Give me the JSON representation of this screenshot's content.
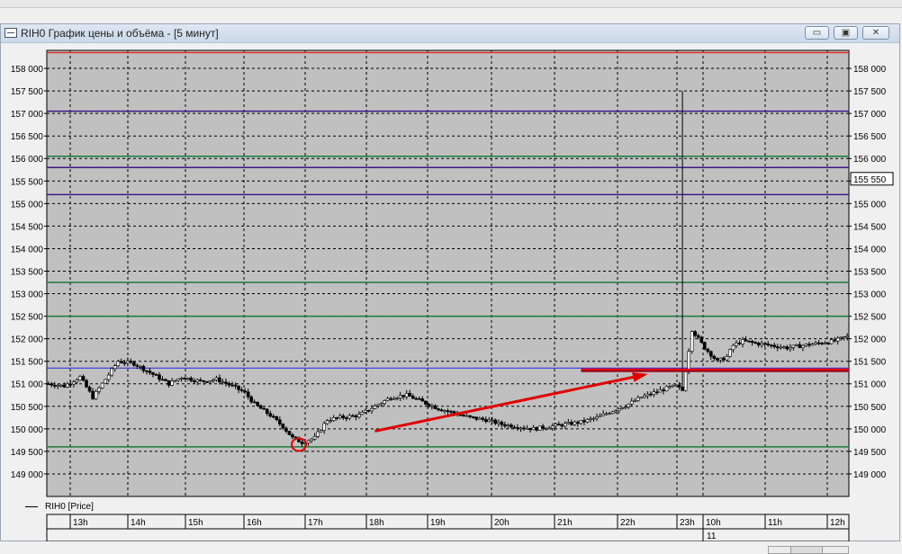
{
  "window": {
    "title": "RIH0 График цены и объёма - [5 минут]",
    "buttons": {
      "minimize": "▭",
      "restore": "▣",
      "close": "✕"
    }
  },
  "legend": {
    "series_label": "RIH0 [Price]"
  },
  "colors": {
    "plot_bg": "#c0c0c0",
    "red_level": "#e03030",
    "purple_level": "#3a1a8a",
    "green_level": "#1e7a3a",
    "blue_level": "#2a2ae0",
    "annotation": "#e00000"
  },
  "chart_data": {
    "type": "candlestick",
    "title": "",
    "xlabel": "",
    "ylabel": "",
    "ylim": [
      148500,
      158400
    ],
    "y_ticks": [
      149000,
      149500,
      150000,
      150500,
      151000,
      151500,
      152000,
      152500,
      153000,
      153500,
      154000,
      154500,
      155000,
      155500,
      156000,
      156500,
      157000,
      157500,
      158000
    ],
    "y_tick_labels": [
      "149 000",
      "149 500",
      "150 000",
      "150 500",
      "151 000",
      "151 500",
      "152 000",
      "152 500",
      "153 000",
      "153 500",
      "154 000",
      "154 500",
      "155 000",
      "155 500",
      "156 000",
      "156 500",
      "157 000",
      "157 500",
      "158 000"
    ],
    "x_hour_labels": [
      "13h",
      "14h",
      "15h",
      "16h",
      "17h",
      "18h",
      "19h",
      "20h",
      "21h",
      "22h",
      "23h",
      "10h",
      "11h",
      "12h"
    ],
    "x_day_labels": [
      "11"
    ],
    "grid": true,
    "last_price_label": "155 550",
    "horizontal_levels": [
      {
        "value": 158350,
        "color": "red"
      },
      {
        "value": 157050,
        "color": "purple"
      },
      {
        "value": 156050,
        "color": "green"
      },
      {
        "value": 155800,
        "color": "purple"
      },
      {
        "value": 155200,
        "color": "purple"
      },
      {
        "value": 153250,
        "color": "green"
      },
      {
        "value": 152500,
        "color": "green"
      },
      {
        "value": 151350,
        "color": "blue"
      },
      {
        "value": 149600,
        "color": "green"
      }
    ],
    "price_path": [
      [
        0,
        151000
      ],
      [
        5,
        150950
      ],
      [
        10,
        151150
      ],
      [
        14,
        150700
      ],
      [
        18,
        151100
      ],
      [
        22,
        151500
      ],
      [
        27,
        151450
      ],
      [
        32,
        151250
      ],
      [
        38,
        151000
      ],
      [
        42,
        151150
      ],
      [
        48,
        151050
      ],
      [
        53,
        151100
      ],
      [
        58,
        150950
      ],
      [
        62,
        150800
      ],
      [
        65,
        150550
      ],
      [
        70,
        150300
      ],
      [
        74,
        150050
      ],
      [
        77,
        149800
      ],
      [
        80,
        149700
      ],
      [
        84,
        149800
      ],
      [
        88,
        150200
      ],
      [
        92,
        150250
      ],
      [
        98,
        150300
      ],
      [
        103,
        150500
      ],
      [
        108,
        150700
      ],
      [
        113,
        150750
      ],
      [
        118,
        150600
      ],
      [
        123,
        150450
      ],
      [
        128,
        150350
      ],
      [
        133,
        150250
      ],
      [
        138,
        150200
      ],
      [
        143,
        150100
      ],
      [
        148,
        150050
      ],
      [
        153,
        150000
      ],
      [
        158,
        150050
      ],
      [
        163,
        150100
      ],
      [
        168,
        150150
      ],
      [
        173,
        150250
      ],
      [
        178,
        150400
      ],
      [
        183,
        150550
      ],
      [
        187,
        150700
      ],
      [
        191,
        150800
      ],
      [
        195,
        150900
      ],
      [
        198,
        150950
      ],
      [
        200,
        150850
      ],
      [
        203,
        152200
      ],
      [
        205,
        152000
      ],
      [
        207,
        151800
      ],
      [
        209,
        151650
      ],
      [
        211,
        151500
      ],
      [
        214,
        151600
      ],
      [
        216,
        151850
      ],
      [
        219,
        151950
      ],
      [
        223,
        151900
      ],
      [
        228,
        151850
      ],
      [
        233,
        151800
      ],
      [
        238,
        151850
      ],
      [
        243,
        151900
      ],
      [
        248,
        151950
      ],
      [
        252,
        152050
      ]
    ],
    "spike": {
      "x": 200,
      "high": 157500,
      "low": 150900
    },
    "annotation_arrow": {
      "from": [
        103,
        149950
      ],
      "to": [
        188,
        151200
      ]
    },
    "annotation_bar": {
      "from_x": 168,
      "to_x": 252,
      "value": 151300
    },
    "annotation_circle": {
      "x": 79,
      "value": 149650
    }
  }
}
